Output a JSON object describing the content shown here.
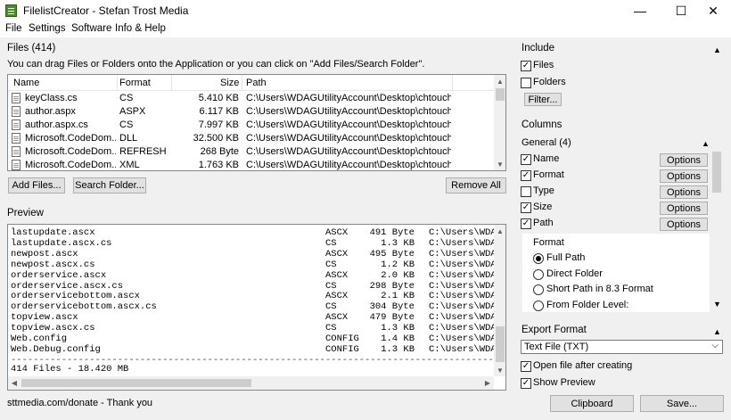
{
  "window": {
    "title": "FilelistCreator - Stefan Trost Media",
    "minimize": "—",
    "maximize": "☐",
    "close": "✕"
  },
  "menu": [
    "File",
    "Settings",
    "Software",
    "Info & Help"
  ],
  "files": {
    "heading": "Files (414)",
    "hint": "You can drag Files or Folders onto the Application or you can click on \"Add Files/Search Folder\".",
    "columns": [
      "Name",
      "Format",
      "Size",
      "Path"
    ],
    "rows": [
      {
        "name": "keyClass.cs",
        "format": "CS",
        "size": "5.410 KB",
        "path": "C:\\Users\\WDAGUtilityAccount\\Desktop\\chtouch -..."
      },
      {
        "name": "author.aspx",
        "format": "ASPX",
        "size": "6.117 KB",
        "path": "C:\\Users\\WDAGUtilityAccount\\Desktop\\chtouch -..."
      },
      {
        "name": "author.aspx.cs",
        "format": "CS",
        "size": "7.997 KB",
        "path": "C:\\Users\\WDAGUtilityAccount\\Desktop\\chtouch -..."
      },
      {
        "name": "Microsoft.CodeDom...",
        "format": "DLL",
        "size": "32.500 KB",
        "path": "C:\\Users\\WDAGUtilityAccount\\Desktop\\chtouch -..."
      },
      {
        "name": "Microsoft.CodeDom...",
        "format": "REFRESH",
        "size": "268 Byte",
        "path": "C:\\Users\\WDAGUtilityAccount\\Desktop\\chtouch -..."
      },
      {
        "name": "Microsoft.CodeDom...",
        "format": "XML",
        "size": "1.763 KB",
        "path": "C:\\Users\\WDAGUtilityAccount\\Desktop\\chtouch -..."
      }
    ],
    "add_files": "Add Files...",
    "search_folder": "Search Folder...",
    "remove_all": "Remove All"
  },
  "preview": {
    "heading": "Preview",
    "lines": [
      {
        "name": "lastupdate.ascx",
        "format": "ASCX",
        "size": "491 Byte",
        "path": "C:\\Users\\WDAG"
      },
      {
        "name": "lastupdate.ascx.cs",
        "format": "CS",
        "size": "1.3 KB",
        "path": "C:\\Users\\WDAG"
      },
      {
        "name": "newpost.ascx",
        "format": "ASCX",
        "size": "495 Byte",
        "path": "C:\\Users\\WDAG"
      },
      {
        "name": "newpost.ascx.cs",
        "format": "CS",
        "size": "1.2 KB",
        "path": "C:\\Users\\WDAG"
      },
      {
        "name": "orderservice.ascx",
        "format": "ASCX",
        "size": "2.0 KB",
        "path": "C:\\Users\\WDAG"
      },
      {
        "name": "orderservice.ascx.cs",
        "format": "CS",
        "size": "298 Byte",
        "path": "C:\\Users\\WDAG"
      },
      {
        "name": "orderservicebottom.ascx",
        "format": "ASCX",
        "size": "2.1 KB",
        "path": "C:\\Users\\WDAG"
      },
      {
        "name": "orderservicebottom.ascx.cs",
        "format": "CS",
        "size": "304 Byte",
        "path": "C:\\Users\\WDAG"
      },
      {
        "name": "topview.ascx",
        "format": "ASCX",
        "size": "479 Byte",
        "path": "C:\\Users\\WDAG"
      },
      {
        "name": "topview.ascx.cs",
        "format": "CS",
        "size": "1.3 KB",
        "path": "C:\\Users\\WDAG"
      },
      {
        "name": "Web.config",
        "format": "CONFIG",
        "size": "1.4 KB",
        "path": "C:\\Users\\WDAG"
      },
      {
        "name": "Web.Debug.config",
        "format": "CONFIG",
        "size": "1.3 KB",
        "path": "C:\\Users\\WDAG"
      }
    ],
    "separator": "------------------------------------------------------------------------------------------------------",
    "summary": "414 Files - 18.420 MB"
  },
  "status": "sttmedia.com/donate - Thank you",
  "bottom_buttons": {
    "clipboard": "Clipboard",
    "save": "Save..."
  },
  "include": {
    "heading": "Include",
    "files_label": "Files",
    "files_checked": true,
    "folders_label": "Folders",
    "folders_checked": false,
    "filter": "Filter..."
  },
  "columns_panel": {
    "heading": "Columns",
    "group": "General (4)",
    "items": [
      {
        "label": "Name",
        "checked": true,
        "options": "Options"
      },
      {
        "label": "Format",
        "checked": true,
        "options": "Options"
      },
      {
        "label": "Type",
        "checked": false,
        "options": "Options"
      },
      {
        "label": "Size",
        "checked": true,
        "options": "Options"
      },
      {
        "label": "Path",
        "checked": true,
        "options": "Options"
      }
    ],
    "format_heading": "Format",
    "format_options": [
      {
        "label": "Full Path",
        "selected": true
      },
      {
        "label": "Direct Folder",
        "selected": false
      },
      {
        "label": "Short Path in 8.3 Format",
        "selected": false
      },
      {
        "label": "From Folder Level:",
        "selected": false
      }
    ]
  },
  "export": {
    "heading": "Export Format",
    "value": "Text File (TXT)",
    "open_after_label": "Open file after creating",
    "open_after_checked": true,
    "show_preview_label": "Show Preview",
    "show_preview_checked": true
  },
  "icons": {
    "check": "✓",
    "up": "▲",
    "down": "▼",
    "left": "◀",
    "right": "▶",
    "chevron": "⌵"
  }
}
